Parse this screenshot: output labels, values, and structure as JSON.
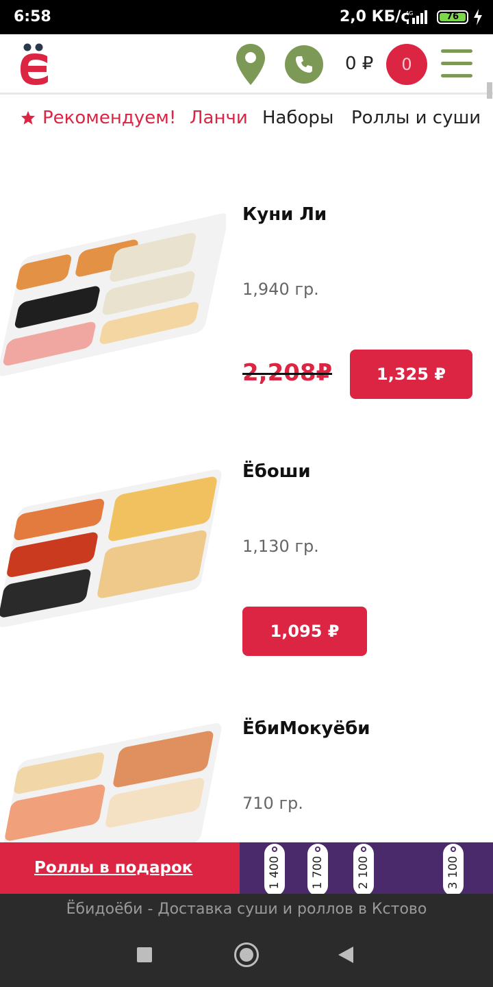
{
  "status_bar": {
    "time": "6:58",
    "speed": "2,0 КБ/с",
    "network": "4G",
    "battery": "76"
  },
  "header": {
    "cart_sum": "0 ₽",
    "cart_count": "0",
    "logo_icon": "yo-letter-logo",
    "location_icon": "map-pin-icon",
    "phone_icon": "phone-icon",
    "menu_icon": "hamburger-icon"
  },
  "tabs": [
    {
      "label": "Рекомендуем!",
      "icon": "star-icon",
      "color": "#dc2543"
    },
    {
      "label": "Ланчи",
      "color": "#dc2543"
    },
    {
      "label": "Наборы",
      "color": "#222222"
    },
    {
      "label": "Роллы и суши",
      "color": "#222222"
    }
  ],
  "products": [
    {
      "name": "Куни Ли",
      "weight": "1,940 гр.",
      "old_price": "2,208₽",
      "price": "1,325 ₽"
    },
    {
      "name": "Ёбоши",
      "weight": "1,130 гр.",
      "price": "1,095 ₽"
    },
    {
      "name": "ЁбиМокуёби",
      "weight": "710 гр."
    }
  ],
  "promo": {
    "link": "Роллы в подарок",
    "tags": [
      "1 400",
      "1 700",
      "2 100",
      "3 100"
    ]
  },
  "footer": {
    "title": "Ёбидоёби - Доставка суши и роллов в Кстово"
  },
  "colors": {
    "brand_red": "#dc2543",
    "olive": "#7c9a55",
    "promo_purple": "#4b2a6b"
  }
}
